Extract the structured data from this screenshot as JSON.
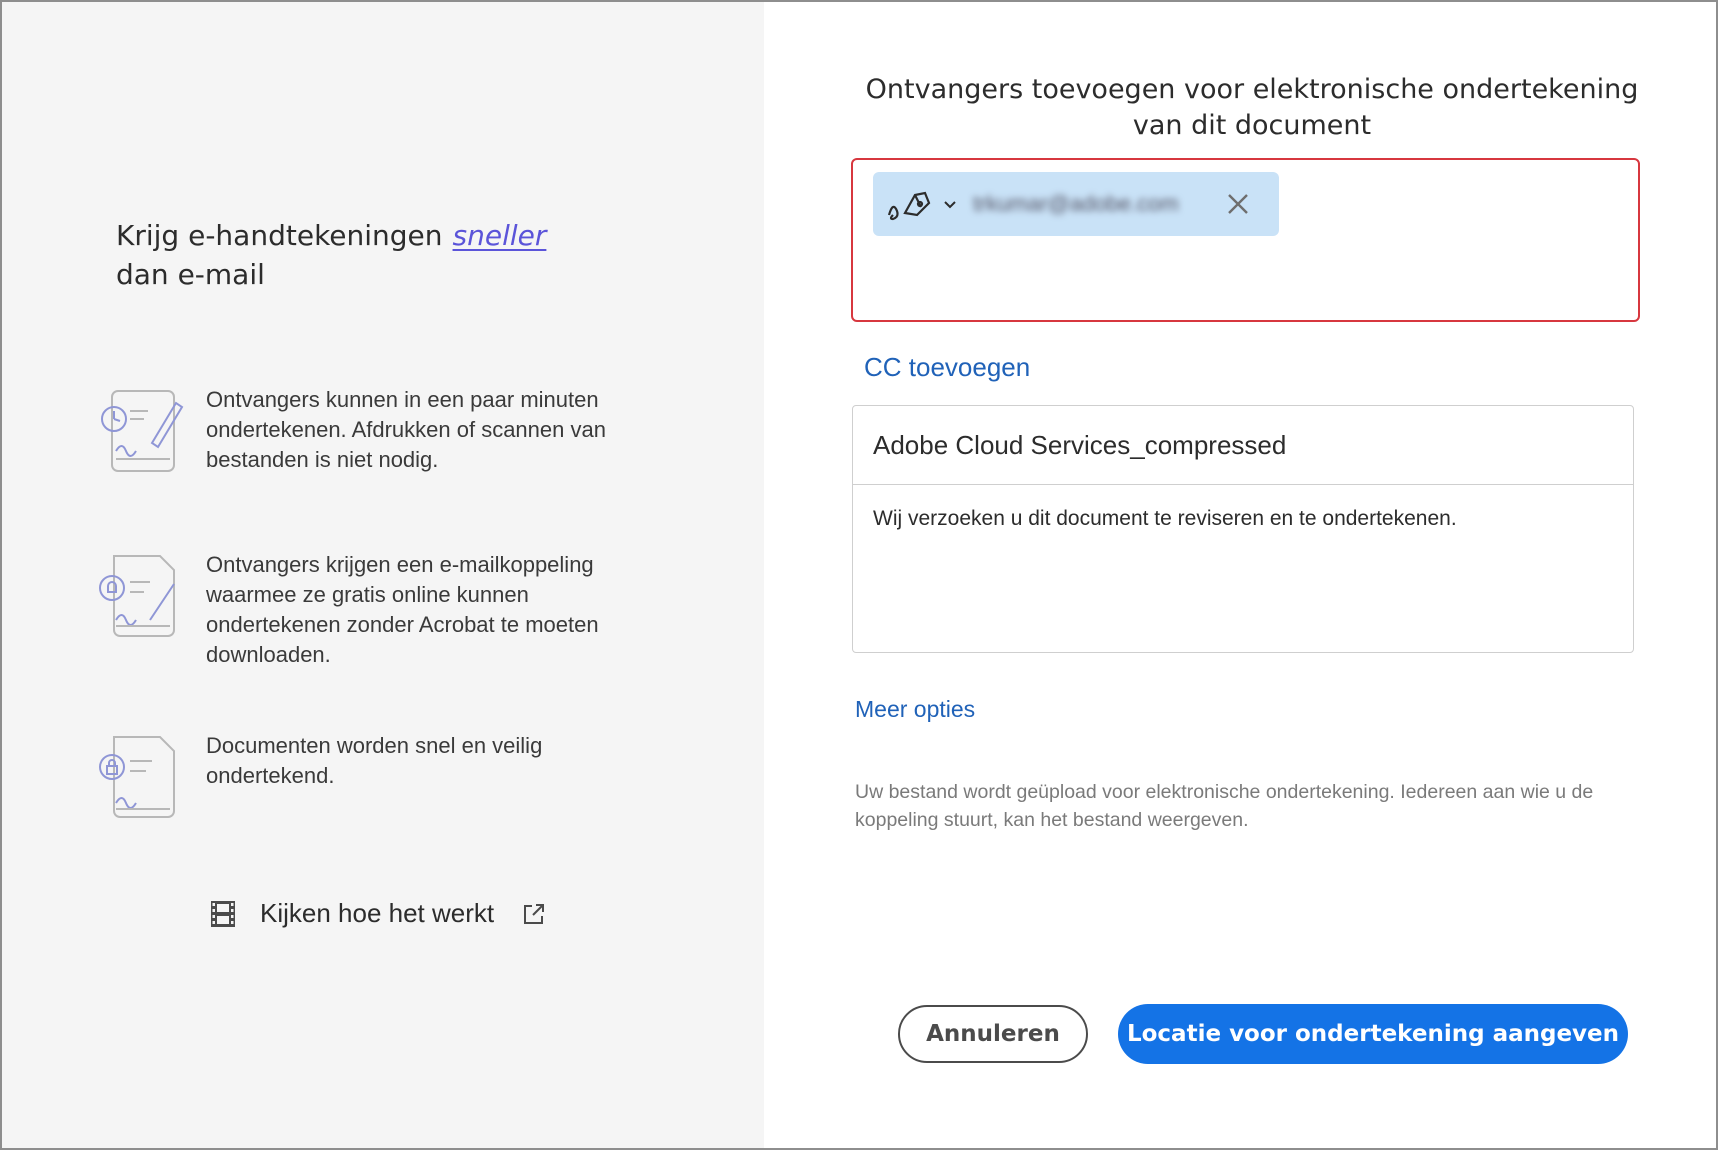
{
  "left": {
    "headline_line1": "Krijg e-handtekeningen",
    "headline_accent": "sneller",
    "headline_line2": "dan e-mail",
    "features": [
      {
        "icon": "sign-quickly-icon",
        "text": "Ontvangers kunnen in een paar minuten ondertekenen. Afdrukken of scannen van bestanden is niet nodig."
      },
      {
        "icon": "email-link-sign-icon",
        "text": "Ontvangers krijgen een e-mailkoppeling waarmee ze gratis online kunnen ondertekenen zonder Acrobat te moeten downloaden."
      },
      {
        "icon": "secure-document-icon",
        "text": "Documenten worden snel en veilig ondertekend."
      }
    ],
    "watch_label": "Kijken hoe het werkt"
  },
  "right": {
    "title": "Ontvangers toevoegen voor elektronische ondertekening van dit document",
    "recipient_email": "trkumar@adobe.com",
    "cc_label": "CC toevoegen",
    "document_name": "Adobe Cloud Services_compressed",
    "message": "Wij verzoeken u dit document te reviseren en te ondertekenen.",
    "more_options": "Meer opties",
    "note": "Uw bestand wordt geüpload voor elektronische ondertekening. Iedereen aan wie u de koppeling stuurt, kan het bestand weergeven.",
    "cancel_label": "Annuleren",
    "primary_label": "Locatie voor ondertekening aangeven"
  },
  "colors": {
    "accent_purple": "#5b54d9",
    "link_blue": "#2062b8",
    "primary_blue": "#1473e6",
    "error_red": "#d7373f",
    "chip_blue": "#c9e2f7"
  }
}
